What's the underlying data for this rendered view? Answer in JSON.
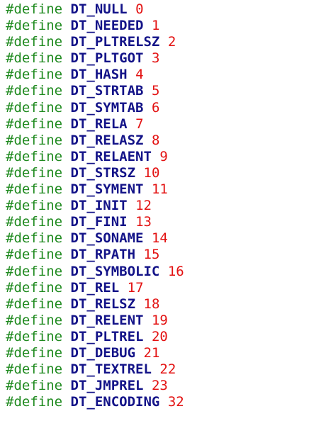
{
  "code": {
    "keyword": "#define",
    "lines": [
      {
        "name": "DT_NULL",
        "value": "0"
      },
      {
        "name": "DT_NEEDED",
        "value": "1"
      },
      {
        "name": "DT_PLTRELSZ",
        "value": "2"
      },
      {
        "name": "DT_PLTGOT",
        "value": "3"
      },
      {
        "name": "DT_HASH",
        "value": "4"
      },
      {
        "name": "DT_STRTAB",
        "value": "5"
      },
      {
        "name": "DT_SYMTAB",
        "value": "6"
      },
      {
        "name": "DT_RELA",
        "value": "7"
      },
      {
        "name": "DT_RELASZ",
        "value": "8"
      },
      {
        "name": "DT_RELAENT",
        "value": "9"
      },
      {
        "name": "DT_STRSZ",
        "value": "10"
      },
      {
        "name": "DT_SYMENT",
        "value": "11"
      },
      {
        "name": "DT_INIT",
        "value": "12"
      },
      {
        "name": "DT_FINI",
        "value": "13"
      },
      {
        "name": "DT_SONAME",
        "value": "14"
      },
      {
        "name": "DT_RPATH",
        "value": "15"
      },
      {
        "name": "DT_SYMBOLIC",
        "value": "16"
      },
      {
        "name": "DT_REL",
        "value": "17"
      },
      {
        "name": "DT_RELSZ",
        "value": "18"
      },
      {
        "name": "DT_RELENT",
        "value": "19"
      },
      {
        "name": "DT_PLTREL",
        "value": "20"
      },
      {
        "name": "DT_DEBUG",
        "value": "21"
      },
      {
        "name": "DT_TEXTREL",
        "value": "22"
      },
      {
        "name": "DT_JMPREL",
        "value": "23"
      },
      {
        "name": "DT_ENCODING",
        "value": "32"
      }
    ]
  },
  "colors": {
    "keyword": "#1f8a1f",
    "identifier": "#131388",
    "number": "#e31212",
    "background": "#ffffff"
  }
}
